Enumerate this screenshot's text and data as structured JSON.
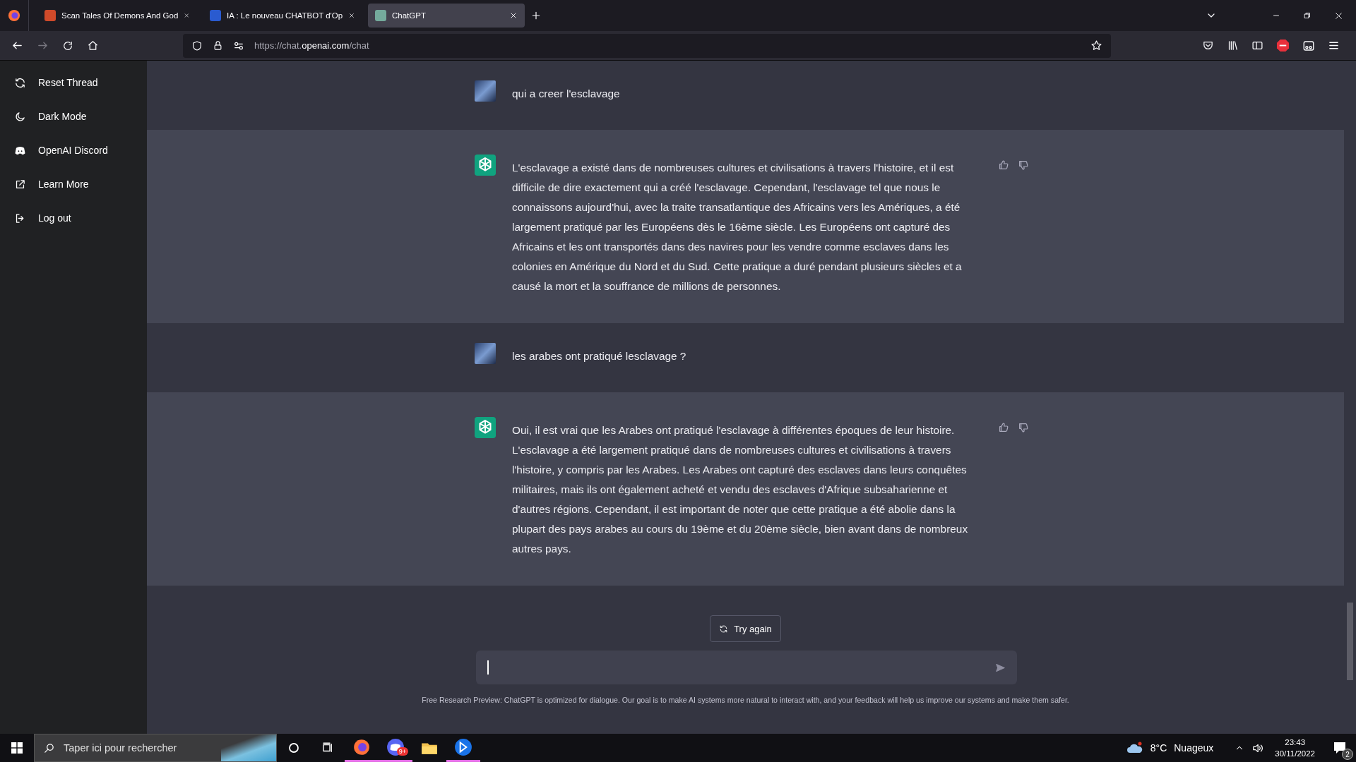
{
  "browser": {
    "tabs": [
      {
        "title": "Scan Tales Of Demons And God",
        "selected": false
      },
      {
        "title": "IA : Le nouveau CHATBOT d'Op",
        "selected": false
      },
      {
        "title": "ChatGPT",
        "selected": true
      }
    ],
    "url_prefix": "https://chat.",
    "url_domain": "openai.com",
    "url_path": "/chat"
  },
  "sidebar": {
    "items": [
      {
        "label": "Reset Thread"
      },
      {
        "label": "Dark Mode"
      },
      {
        "label": "OpenAI Discord"
      },
      {
        "label": "Learn More"
      },
      {
        "label": "Log out"
      }
    ]
  },
  "thread": {
    "messages": [
      {
        "kind": "user",
        "text": "qui a creer l'esclavage"
      },
      {
        "kind": "assistant",
        "text": "L'esclavage a existé dans de nombreuses cultures et civilisations à travers l'histoire, et il est difficile de dire exactement qui a créé l'esclavage. Cependant, l'esclavage tel que nous le connaissons aujourd'hui, avec la traite transatlantique des Africains vers les Amériques, a été largement pratiqué par les Européens dès le 16ème siècle. Les Européens ont capturé des Africains et les ont transportés dans des navires pour les vendre comme esclaves dans les colonies en Amérique du Nord et du Sud. Cette pratique a duré pendant plusieurs siècles et a causé la mort et la souffrance de millions de personnes."
      },
      {
        "kind": "user",
        "text": "les arabes ont pratiqué lesclavage ?"
      },
      {
        "kind": "assistant",
        "text": "Oui, il est vrai que les Arabes ont pratiqué l'esclavage à différentes époques de leur histoire. L'esclavage a été largement pratiqué dans de nombreuses cultures et civilisations à travers l'histoire, y compris par les Arabes. Les Arabes ont capturé des esclaves dans leurs conquêtes militaires, mais ils ont également acheté et vendu des esclaves d'Afrique subsaharienne et d'autres régions. Cependant, il est important de noter que cette pratique a été abolie dans la plupart des pays arabes au cours du 19ème et du 20ème siècle, bien avant dans de nombreux autres pays."
      }
    ],
    "try_again": "Try again",
    "footer": "Free Research Preview: ChatGPT is optimized for dialogue. Our goal is to make AI systems more natural to interact with, and your feedback will help us improve our systems and make them safer."
  },
  "taskbar": {
    "search_placeholder": "Taper ici pour rechercher",
    "apps": [
      {
        "kind": "firefox",
        "active": true
      },
      {
        "kind": "discord",
        "active": true,
        "badge": "9+"
      },
      {
        "kind": "explorer",
        "active": false
      },
      {
        "kind": "app",
        "active": true
      }
    ],
    "temperature": "8°C",
    "weather": "Nuageux",
    "time": "23:43",
    "date": "30/11/2022",
    "notifications": "2"
  }
}
